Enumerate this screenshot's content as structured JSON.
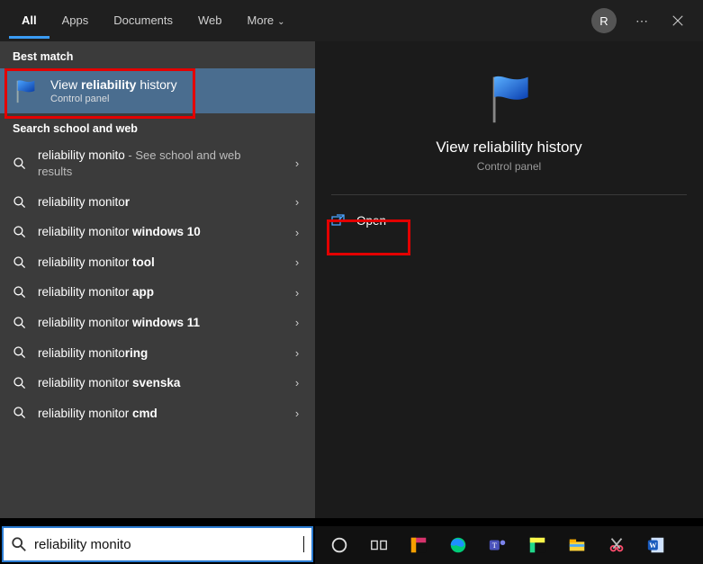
{
  "tabs": {
    "all": "All",
    "apps": "Apps",
    "documents": "Documents",
    "web": "Web",
    "more": "More"
  },
  "titlebar": {
    "avatar_letter": "R"
  },
  "sections": {
    "best": "Best match",
    "web": "Search school and web"
  },
  "best_match": {
    "title_prefix": "View ",
    "title_bold": "reliability",
    "title_suffix": " history",
    "subtitle": "Control panel"
  },
  "results": [
    {
      "prefix": "reliability monito",
      "bold": "",
      "suffix": "",
      "extra": " - See school and web results"
    },
    {
      "prefix": "reliability monito",
      "bold": "r",
      "suffix": "",
      "extra": ""
    },
    {
      "prefix": "reliability monito",
      "bold": "",
      "suffix": "r ",
      "boldEnd": "windows 10",
      "extra": ""
    },
    {
      "prefix": "reliability monito",
      "bold": "",
      "suffix": "r ",
      "boldEnd": "tool",
      "extra": ""
    },
    {
      "prefix": "reliability monito",
      "bold": "",
      "suffix": "r ",
      "boldEnd": "app",
      "extra": ""
    },
    {
      "prefix": "reliability monito",
      "bold": "",
      "suffix": "r ",
      "boldEnd": "windows 11",
      "extra": ""
    },
    {
      "prefix": "reliability monito",
      "bold": "ring",
      "suffix": "",
      "extra": ""
    },
    {
      "prefix": "reliability monito",
      "bold": "",
      "suffix": "r ",
      "boldEnd": "svenska",
      "extra": ""
    },
    {
      "prefix": "reliability monito",
      "bold": "",
      "suffix": "r ",
      "boldEnd": "cmd",
      "extra": ""
    }
  ],
  "detail": {
    "title": "View reliability history",
    "subtitle": "Control panel",
    "open": "Open"
  },
  "search": {
    "value": "reliability monito"
  },
  "taskbar_icons": [
    "cortana",
    "task-view",
    "intellij",
    "edge",
    "teams",
    "pycharm",
    "explorer",
    "snip",
    "word"
  ]
}
